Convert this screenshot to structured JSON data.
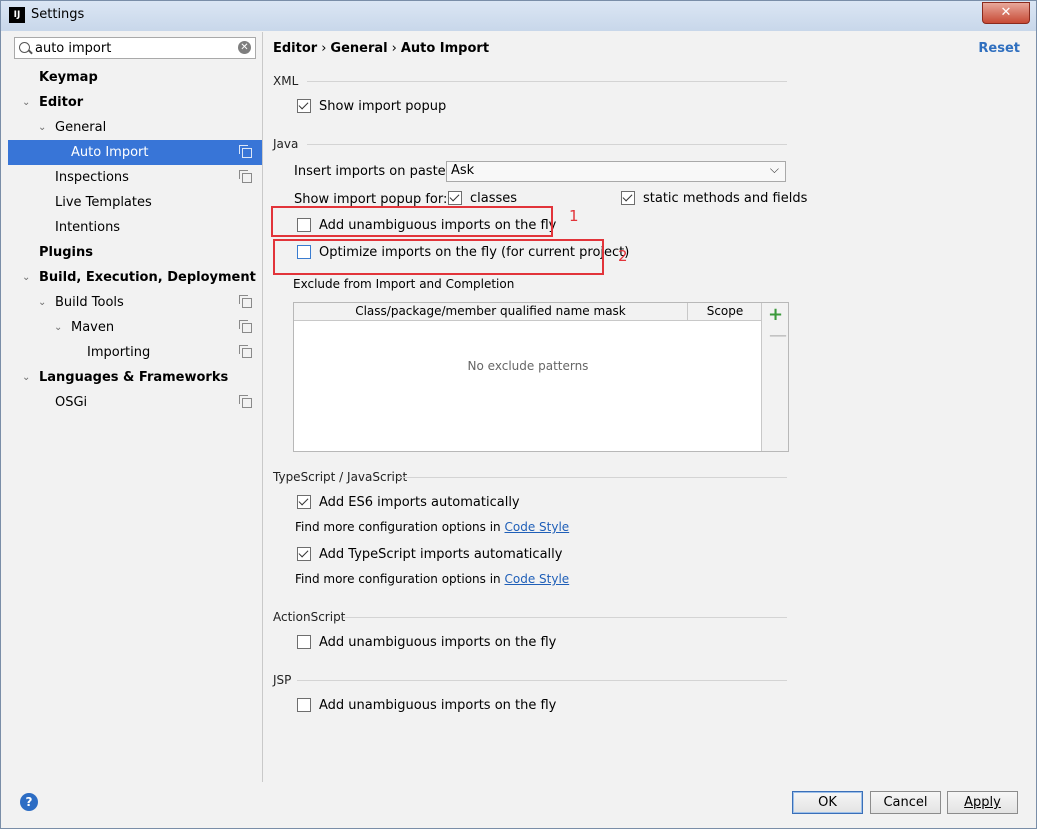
{
  "window": {
    "title": "Settings",
    "app_icon_text": "IJ",
    "close_glyph": "✕"
  },
  "search": {
    "value": "auto import",
    "placeholder": ""
  },
  "tree": [
    {
      "label": "Keymap",
      "level": 0,
      "bold": true,
      "chevron": "",
      "copy": false,
      "selected": false
    },
    {
      "label": "Editor",
      "level": 0,
      "bold": true,
      "chevron": "⌄",
      "copy": false,
      "selected": false
    },
    {
      "label": "General",
      "level": 1,
      "bold": false,
      "chevron": "⌄",
      "copy": false,
      "selected": false
    },
    {
      "label": "Auto Import",
      "level": 2,
      "bold": false,
      "chevron": "",
      "copy": true,
      "selected": true
    },
    {
      "label": "Inspections",
      "level": 1,
      "bold": false,
      "chevron": "",
      "copy": true,
      "selected": false
    },
    {
      "label": "Live Templates",
      "level": 1,
      "bold": false,
      "chevron": "",
      "copy": false,
      "selected": false
    },
    {
      "label": "Intentions",
      "level": 1,
      "bold": false,
      "chevron": "",
      "copy": false,
      "selected": false
    },
    {
      "label": "Plugins",
      "level": 0,
      "bold": true,
      "chevron": "",
      "copy": false,
      "selected": false
    },
    {
      "label": "Build, Execution, Deployment",
      "level": 0,
      "bold": true,
      "chevron": "⌄",
      "copy": false,
      "selected": false
    },
    {
      "label": "Build Tools",
      "level": 1,
      "bold": false,
      "chevron": "⌄",
      "copy": true,
      "selected": false
    },
    {
      "label": "Maven",
      "level": 2,
      "bold": false,
      "chevron": "⌄",
      "copy": true,
      "selected": false
    },
    {
      "label": "Importing",
      "level": 3,
      "bold": false,
      "chevron": "",
      "copy": true,
      "selected": false
    },
    {
      "label": "Languages & Frameworks",
      "level": 0,
      "bold": true,
      "chevron": "⌄",
      "copy": false,
      "selected": false
    },
    {
      "label": "OSGi",
      "level": 1,
      "bold": false,
      "chevron": "",
      "copy": true,
      "selected": false
    }
  ],
  "breadcrumb": {
    "part1": "Editor",
    "part2": "General",
    "part3": "Auto Import",
    "sep": "›"
  },
  "reset_label": "Reset",
  "xml": {
    "section": "XML",
    "show_popup": {
      "label": "Show import popup",
      "checked": true
    }
  },
  "java": {
    "section": "Java",
    "insert_label": "Insert imports on paste:",
    "insert_value": "Ask",
    "popup_label": "Show import popup for:",
    "classes": {
      "label": "classes",
      "checked": true
    },
    "static": {
      "label": "static methods and fields",
      "checked": true
    },
    "add_unambiguous": {
      "label": "Add unambiguous imports on the fly",
      "checked": false
    },
    "optimize": {
      "label": "Optimize imports on the fly (for current project)",
      "checked": false
    },
    "exclude_label": "Exclude from Import and Completion",
    "table": {
      "col1": "Class/package/member qualified name mask",
      "col2": "Scope",
      "empty": "No exclude patterns"
    }
  },
  "ts": {
    "section": "TypeScript / JavaScript",
    "es6": {
      "label": "Add ES6 imports automatically",
      "checked": true
    },
    "ts_imports": {
      "label": "Add TypeScript imports automatically",
      "checked": true
    },
    "more_text": "Find more configuration options in",
    "link": "Code Style"
  },
  "actionscript": {
    "section": "ActionScript",
    "add": {
      "label": "Add unambiguous imports on the fly",
      "checked": false
    }
  },
  "jsp": {
    "section": "JSP",
    "add": {
      "label": "Add unambiguous imports on the fly",
      "checked": false
    }
  },
  "annotations": {
    "n1": "1",
    "n2": "2",
    "color": "#e2343a"
  },
  "buttons": {
    "ok": "OK",
    "cancel": "Cancel",
    "apply": "Apply"
  },
  "accent": "#3875d7"
}
